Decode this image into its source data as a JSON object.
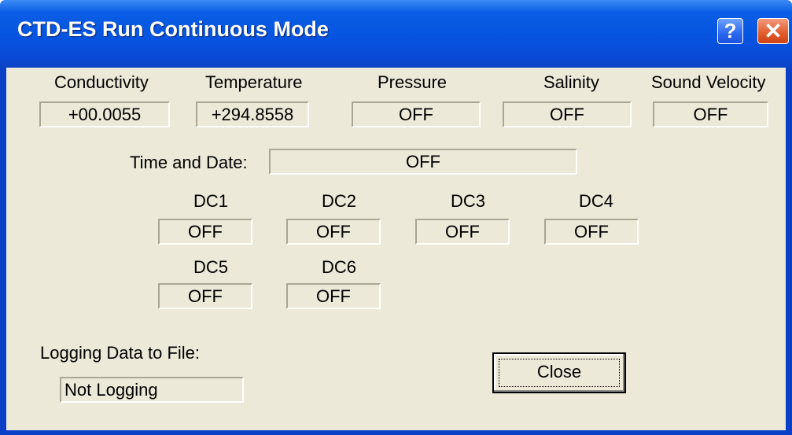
{
  "window": {
    "title": "CTD-ES Run Continuous Mode",
    "help_glyph": "?",
    "close_glyph": "✕"
  },
  "sensors": {
    "conductivity": {
      "label": "Conductivity",
      "value": "+00.0055"
    },
    "temperature": {
      "label": "Temperature",
      "value": "+294.8558"
    },
    "pressure": {
      "label": "Pressure",
      "value": "OFF"
    },
    "salinity": {
      "label": "Salinity",
      "value": "OFF"
    },
    "sound_velocity": {
      "label": "Sound Velocity",
      "value": "OFF"
    }
  },
  "time_date": {
    "label": "Time and Date:",
    "value": "OFF"
  },
  "dc": [
    {
      "label": "DC1",
      "value": "OFF"
    },
    {
      "label": "DC2",
      "value": "OFF"
    },
    {
      "label": "DC3",
      "value": "OFF"
    },
    {
      "label": "DC4",
      "value": "OFF"
    },
    {
      "label": "DC5",
      "value": "OFF"
    },
    {
      "label": "DC6",
      "value": "OFF"
    }
  ],
  "logging": {
    "label": "Logging Data to File:",
    "value": "Not Logging"
  },
  "buttons": {
    "close_label": "Close"
  },
  "colors": {
    "title_bar": "#0654e0",
    "dialog_bg": "#ece9d8",
    "close_button": "#e15b2c"
  }
}
